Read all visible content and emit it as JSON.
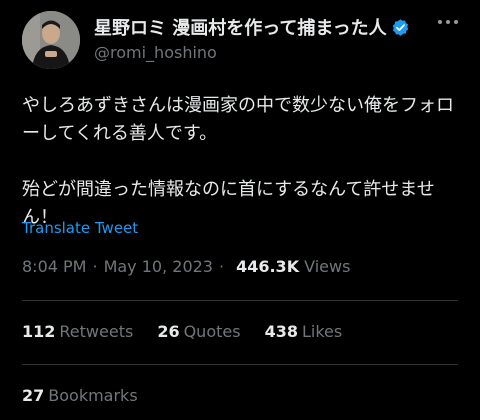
{
  "author": {
    "display_name": "星野ロミ 漫画村を作って捕まった人",
    "handle": "@romi_hoshino",
    "verified_icon": "verified-badge-icon",
    "verified_color": "#1d9bf0"
  },
  "tweet": {
    "line1": "やしろあずきさんは漫画家の中で数少ない俺をフォローしてくれる善人です。",
    "line2": "殆どが間違った情報なのに首にするなんて許せません！",
    "translate_label": "Translate Tweet"
  },
  "meta": {
    "time": "8:04 PM",
    "separator": "·",
    "date": "May 10, 2023",
    "views_count": "446.3K",
    "views_label": "Views"
  },
  "stats": {
    "retweets_count": "112",
    "retweets_label": "Retweets",
    "quotes_count": "26",
    "quotes_label": "Quotes",
    "likes_count": "438",
    "likes_label": "Likes"
  },
  "bookmarks": {
    "count": "27",
    "label": "Bookmarks"
  },
  "colors": {
    "background": "#000000",
    "text": "#e7e9ea",
    "muted": "#71767b",
    "link": "#1d9bf0",
    "divider": "#2f3336"
  }
}
